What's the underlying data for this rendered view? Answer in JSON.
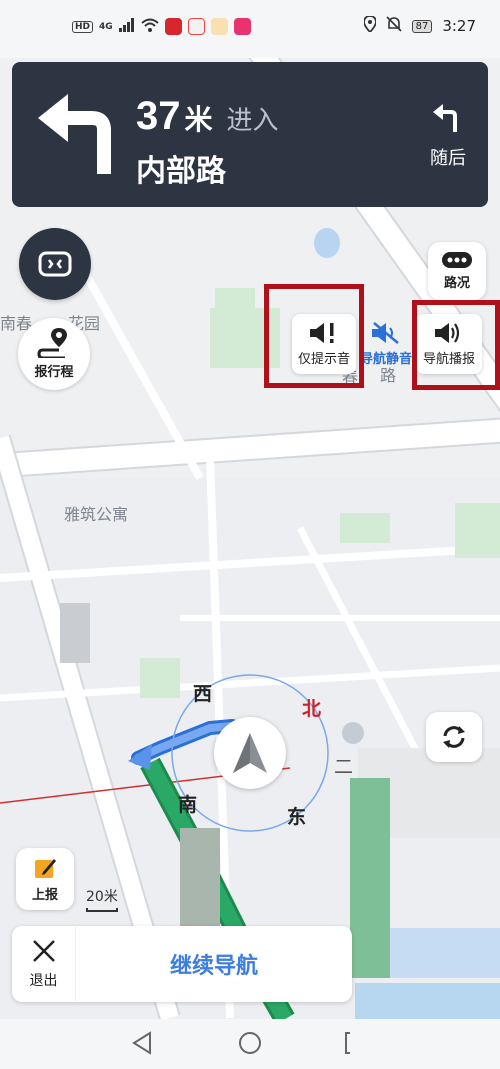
{
  "status_bar": {
    "left_label": "HD",
    "network": "4G",
    "battery": "87",
    "time": "3:27"
  },
  "nav_card": {
    "distance": "37",
    "distance_unit": "米",
    "action": "进入",
    "road": "内部路",
    "next_label": "随后"
  },
  "map": {
    "labels": [
      "南春",
      "花园",
      "雅筑公寓",
      "春",
      "路",
      "二"
    ]
  },
  "buttons": {
    "traffic": "路况",
    "report_trip": "报行程",
    "report": "上报",
    "exit": "退出",
    "continue_nav": "继续导航"
  },
  "voice_modes": {
    "alert_only": "仅提示音",
    "nav_mute": "导航静音",
    "nav_broadcast": "导航播报"
  },
  "compass": {
    "west": "西",
    "north": "北",
    "south": "南",
    "east": "东"
  },
  "scale": "20米",
  "colors": {
    "card": "#2d3543",
    "accent_blue": "#3d7de0",
    "highlight_red": "#b0101a",
    "route_green": "#2aa865"
  }
}
